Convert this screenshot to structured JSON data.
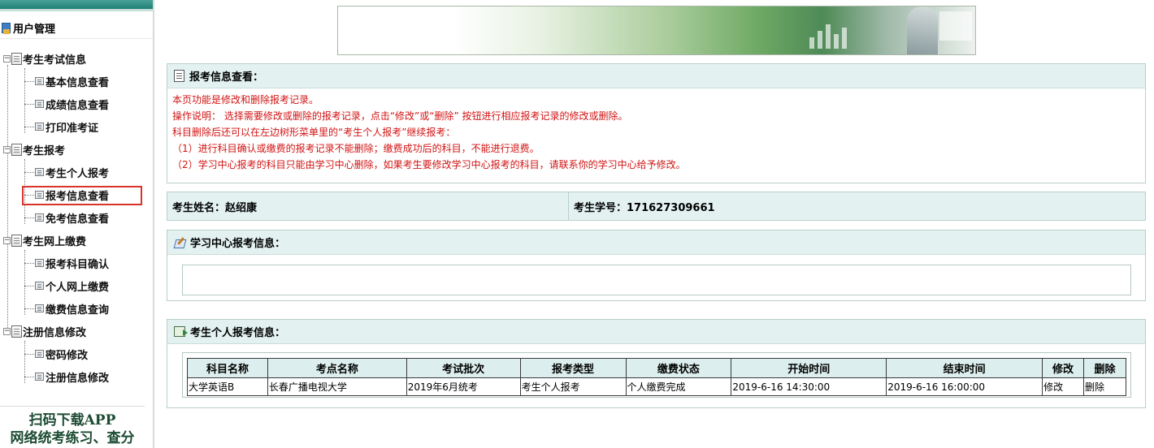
{
  "sidebar": {
    "user_mgmt": "用户管理",
    "groups": [
      {
        "label": "考生考试信息",
        "items": [
          "基本信息查看",
          "成绩信息查看",
          "打印准考证"
        ]
      },
      {
        "label": "考生报考",
        "items": [
          "考生个人报考",
          "报考信息查看",
          "免考信息查看"
        ]
      },
      {
        "label": "考生网上缴费",
        "items": [
          "报考科目确认",
          "个人网上缴费",
          "缴费信息查询"
        ]
      },
      {
        "label": "注册信息修改",
        "items": [
          "密码修改",
          "注册信息修改"
        ]
      }
    ],
    "active_item": "报考信息查看",
    "promo_line1": "扫码下载APP",
    "promo_line2": "网络统考练习、查分"
  },
  "report_view": {
    "title": "报考信息查看：",
    "notes": [
      " 本页功能是修改和删除报考记录。",
      "操作说明： 选择需要修改或删除的报考记录，点击“修改”或“删除” 按钮进行相应报考记录的修改或删除。",
      "科目删除后还可以在左边树形菜单里的“考生个人报考”继续报考：",
      "（1）进行科目确认或缴费的报考记录不能删除；缴费成功后的科目，不能进行退费。",
      "（2）学习中心报考的科目只能由学习中心删除，如果考生要修改学习中心报考的科目，请联系你的学习中心给予修改。"
    ]
  },
  "student": {
    "name_label": "考生姓名：赵绍康",
    "id_label": "考生学号：171627309661"
  },
  "center_section": {
    "title": "学习中心报考信息："
  },
  "personal_section": {
    "title": "考生个人报考信息：",
    "columns": [
      "科目名称",
      "考点名称",
      "考试批次",
      "报考类型",
      "缴费状态",
      "开始时间",
      "结束时间",
      "修改",
      "删除"
    ],
    "rows": [
      {
        "subject": "大学英语B",
        "site": "长春广播电视大学",
        "batch": "2019年6月统考",
        "type": "考生个人报考",
        "pay_status": "个人缴费完成",
        "start": "2019-6-16 14:30:00",
        "end": "2019-6-16 16:00:00",
        "edit": "修改",
        "delete": "删除"
      }
    ]
  },
  "colors": {
    "notes_text": "#d21414",
    "panel_header": "#e3f2f1",
    "highlight": "#d9342b"
  }
}
